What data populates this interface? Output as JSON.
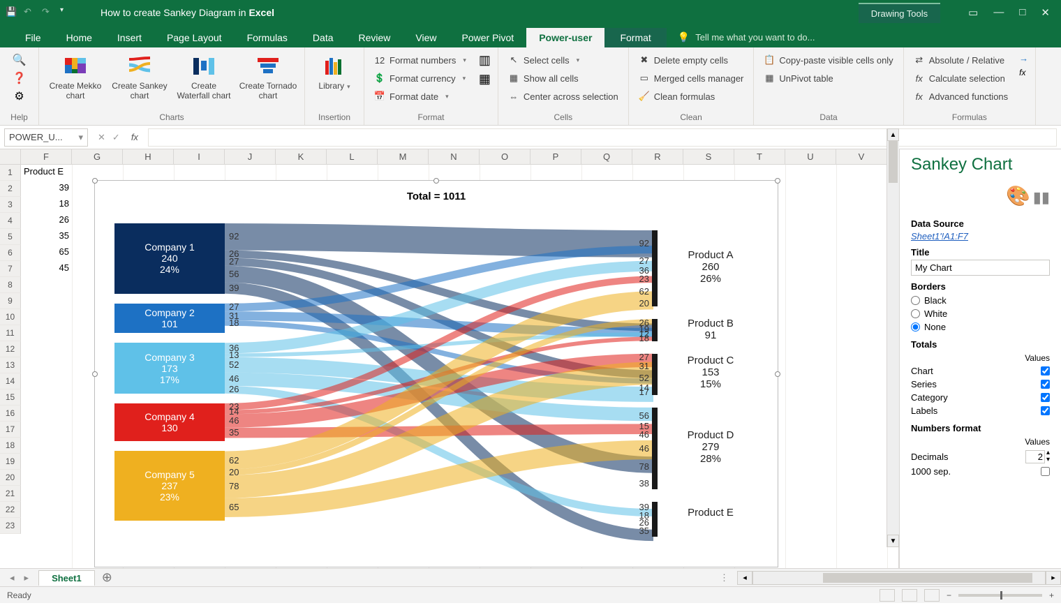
{
  "titlebar": {
    "title_prefix": "How to create Sankey Diagram in ",
    "title_app": "Excel",
    "context_tab": "Drawing Tools"
  },
  "tabs": {
    "items": [
      "File",
      "Home",
      "Insert",
      "Page Layout",
      "Formulas",
      "Data",
      "Review",
      "View",
      "Power Pivot",
      "Power-user",
      "Format"
    ],
    "active": "Power-user",
    "tellme": "Tell me what you want to do..."
  },
  "ribbon": {
    "help_label": "Help",
    "charts": {
      "label": "Charts",
      "mekko": "Create\nMekko chart",
      "sankey": "Create\nSankey chart",
      "waterfall": "Create\nWaterfall chart",
      "tornado": "Create\nTornado chart"
    },
    "insertion": {
      "label": "Insertion",
      "library": "Library"
    },
    "format": {
      "label": "Format",
      "numbers": "Format numbers",
      "currency": "Format currency",
      "date": "Format date"
    },
    "cells": {
      "label": "Cells",
      "select": "Select cells",
      "show": "Show all cells",
      "center": "Center across selection"
    },
    "clean": {
      "label": "Clean",
      "delete": "Delete empty cells",
      "merged": "Merged cells manager",
      "formulas": "Clean formulas"
    },
    "data": {
      "label": "Data",
      "copy": "Copy-paste visible cells only",
      "unpivot": "UnPivot table"
    },
    "formulas": {
      "label": "Formulas",
      "abs": "Absolute / Relative",
      "calc": "Calculate selection",
      "adv": "Advanced functions"
    }
  },
  "namebox": "POWER_U...",
  "columns": [
    "F",
    "G",
    "H",
    "I",
    "J",
    "K",
    "L",
    "M",
    "N",
    "O",
    "P",
    "Q",
    "R",
    "S",
    "T",
    "U",
    "V"
  ],
  "row_count": 23,
  "spreadsheet_cells": {
    "F1": "Product E",
    "F2": "39",
    "F3": "18",
    "F4": "26",
    "F5": "35",
    "F6": "65",
    "F7": "45"
  },
  "chart_data": {
    "type": "sankey",
    "title": "Total = 1011",
    "sources": [
      {
        "name": "Company 1",
        "value": 240,
        "pct": "24%",
        "color": "#0a2d5e",
        "outflows": [
          92,
          26,
          27,
          56,
          39
        ]
      },
      {
        "name": "Company 2",
        "value": 101,
        "pct": "",
        "color": "#1d71c4",
        "outflows": [
          27,
          31,
          18
        ]
      },
      {
        "name": "Company 3",
        "value": 173,
        "pct": "17%",
        "color": "#5fc1e8",
        "outflows": [
          36,
          13,
          52,
          46,
          26
        ]
      },
      {
        "name": "Company 4",
        "value": 130,
        "pct": "",
        "color": "#e0201c",
        "outflows": [
          23,
          14,
          46,
          35
        ]
      },
      {
        "name": "Company 5",
        "value": 237,
        "pct": "23%",
        "color": "#efb020",
        "outflows": [
          62,
          20,
          78,
          65
        ]
      }
    ],
    "targets": [
      {
        "name": "Product A",
        "value": 260,
        "pct": "26%",
        "inflows": [
          92,
          27,
          36,
          23,
          62,
          20
        ]
      },
      {
        "name": "Product B",
        "value": 91,
        "pct": "",
        "inflows": [
          26,
          19,
          12,
          18
        ]
      },
      {
        "name": "Product C",
        "value": 153,
        "pct": "15%",
        "inflows": [
          27,
          31,
          52,
          14,
          17
        ]
      },
      {
        "name": "Product D",
        "value": 279,
        "pct": "28%",
        "inflows": [
          56,
          15,
          46,
          46,
          78,
          38
        ]
      },
      {
        "name": "Product E",
        "value": null,
        "pct": "",
        "inflows": [
          39,
          18,
          26,
          35
        ]
      }
    ]
  },
  "panel": {
    "title": "Sankey Chart",
    "data_source_label": "Data Source",
    "data_source": "Sheet1'!A1:F7",
    "title_label": "Title",
    "title_value": "My Chart",
    "borders_label": "Borders",
    "border_opts": [
      "Black",
      "White",
      "None"
    ],
    "border_selected": "None",
    "totals_label": "Totals",
    "values_hdr": "Values",
    "totals": [
      "Chart",
      "Series",
      "Category",
      "Labels"
    ],
    "nf_label": "Numbers format",
    "decimals_label": "Decimals",
    "decimals_value": "2",
    "sep_label": "1000 sep."
  },
  "sheet_tab": "Sheet1",
  "status": "Ready"
}
